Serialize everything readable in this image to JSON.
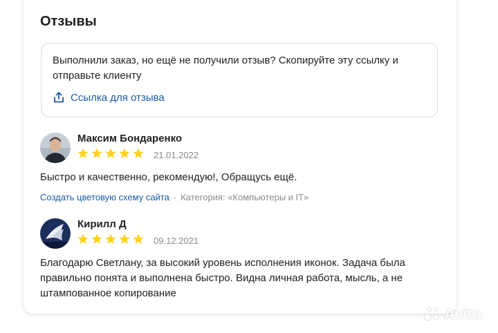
{
  "reviews_section": {
    "title": "Отзывы",
    "invite_text": "Выполнили заказ, но ещё не получили отзыв? Скопируйте эту ссылку и отправьте клиенту",
    "invite_link_label": "Ссылка для отзыва",
    "invite_link_icon": "share-icon"
  },
  "reviews": [
    {
      "author": "Максим Бондаренко",
      "rating": 5,
      "rating_max": 5,
      "date": "21.01.2022",
      "text": "Быстро и качественно, рекомендую!, Обращусь ещё.",
      "service_link": "Создать цветовую схему сайта",
      "separator": "·",
      "category": "Категория: «Компьютеры и IT»"
    },
    {
      "author": "Кирилл Д",
      "rating": 5,
      "rating_max": 5,
      "date": "09.12.2021",
      "text": "Благодарю Светлану, за высокий уровень исполнения иконок. Задача была правильно понята и выполнена быстро. Видна личная работа, мысль, а не штампованное копирование"
    }
  ],
  "colors": {
    "link": "#1a5aa8",
    "star": "#ffd21f",
    "muted": "#8a8a8a"
  },
  "watermark": {
    "text": "Avito"
  }
}
